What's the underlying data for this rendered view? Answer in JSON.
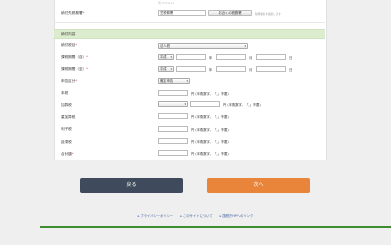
{
  "top": {
    "faint_text": "例) 2711111",
    "tax_office_label": "納付先税務署",
    "tax_office_required": "*",
    "tax_office_value": "芝税務署",
    "tax_office_search_button": "お近くの税務署",
    "tax_office_note": "税務署名を検索します"
  },
  "section": {
    "title": "納付内容"
  },
  "form": {
    "tax_item": {
      "label": "納付税目",
      "required": "*",
      "value": "法人税"
    },
    "period_from": {
      "label": "課税期間（自）",
      "required": "*",
      "era": "平成",
      "year": "年",
      "month": "月",
      "day": "日"
    },
    "period_to": {
      "label": "課税期間（至）",
      "required": "*",
      "era": "平成",
      "year": "年",
      "month": "月",
      "day": "日"
    },
    "declaration": {
      "label": "申告区分",
      "required": "*",
      "value": "確定申告"
    },
    "honzei": {
      "label": "本税",
      "unit": "円 (半角数字、「,」不要)"
    },
    "kasanzei": {
      "label": "加算税",
      "unit": "円 (半角数字、「,」不要)"
    },
    "jukasanzei": {
      "label": "重加算税",
      "unit": "円 (半角数字、「,」不要)"
    },
    "rishizei": {
      "label": "利子税",
      "unit": "円 (半角数字、「,」不要)"
    },
    "entaizei": {
      "label": "延滞税",
      "unit": "円 (半角数字、「,」不要)"
    },
    "total": {
      "label": "合計額",
      "required": "*",
      "unit": "円 (半角数字、「,」不要)"
    }
  },
  "buttons": {
    "back": "戻る",
    "next": "次へ"
  },
  "footer": {
    "links": [
      "プライバシーポリシー",
      "このサイトについて",
      "国税庁HPへのリンク"
    ]
  },
  "colors": {
    "back_button": "#3f4a5c",
    "next_button": "#e9853a",
    "section_bg": "#dceccf",
    "footer_bar": "#3e8e2f"
  }
}
